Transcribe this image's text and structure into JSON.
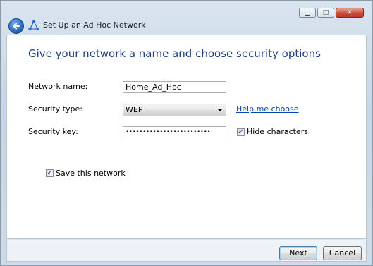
{
  "window": {
    "title": "Set Up an Ad Hoc Network",
    "minimize_glyph": "▁",
    "maximize_glyph": "□",
    "close_glyph": "✕"
  },
  "main": {
    "heading": "Give your network a name and choose security options",
    "network_name_label": "Network name:",
    "network_name_value": "Home_Ad_Hoc",
    "security_type_label": "Security type:",
    "security_type_value": "WEP",
    "help_link": "Help me choose",
    "security_key_label": "Security key:",
    "security_key_value": "•••••••••••••••••••••••••",
    "hide_characters_label": "Hide characters",
    "hide_characters_checked": true,
    "save_network_label": "Save this network",
    "save_network_checked": true
  },
  "footer": {
    "next_label": "Next",
    "cancel_label": "Cancel"
  },
  "colors": {
    "heading": "#1f3e8a",
    "link": "#0645ad"
  },
  "icons": {
    "back": "back-arrow-icon",
    "network": "network-icon"
  }
}
